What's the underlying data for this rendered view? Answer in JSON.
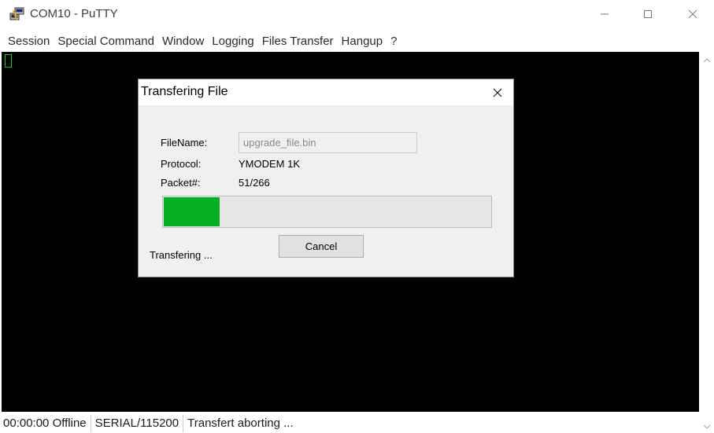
{
  "window": {
    "title": "COM10 - PuTTY",
    "icon": "putty-icon",
    "controls": {
      "minimize_icon": "minimize-icon",
      "maximize_icon": "maximize-icon",
      "close_icon": "close-icon"
    }
  },
  "menu": {
    "items": [
      {
        "label": "Session"
      },
      {
        "label": "Special Command"
      },
      {
        "label": "Window"
      },
      {
        "label": "Logging"
      },
      {
        "label": "Files Transfer"
      },
      {
        "label": "Hangup"
      },
      {
        "label": "?"
      }
    ]
  },
  "terminal": {
    "background": "#000000",
    "cursor_color": "#19c819"
  },
  "statusbar": {
    "time": "00:00:00",
    "state": "Offline",
    "connection": "SERIAL/115200",
    "message": "Transfert aborting ..."
  },
  "dialog": {
    "title": "Transfering File",
    "filename_label": "FileName:",
    "filename_value": "upgrade_file.bin",
    "protocol_label": "Protocol:",
    "protocol_value": "YMODEM 1K",
    "packet_label": "Packet#:",
    "packet_value": "51/266",
    "progress_fraction": 0.17,
    "progress_color": "#06b025",
    "cancel_label": "Cancel",
    "status_text": "Transfering ..."
  }
}
